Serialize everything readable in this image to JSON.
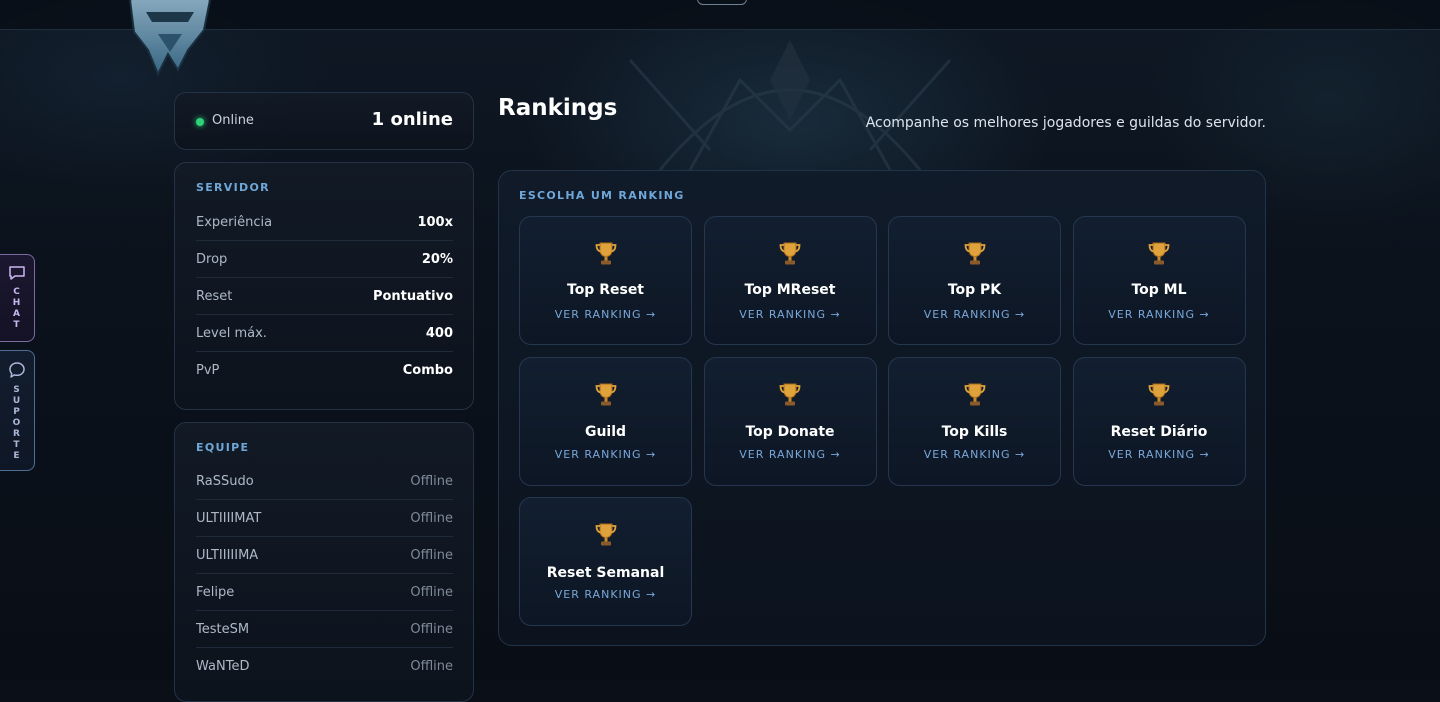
{
  "topbar": {},
  "side_tabs": {
    "chat": {
      "label": "CHAT",
      "icon": "chat-bubble-icon"
    },
    "suporte": {
      "label": "SUPORTE",
      "icon": "support-bubble-icon"
    }
  },
  "online": {
    "label": "Online",
    "count": "1 online",
    "status_color": "#2fd37a"
  },
  "server": {
    "title": "SERVIDOR",
    "rows": [
      {
        "key": "Experiência",
        "value": "100x"
      },
      {
        "key": "Drop",
        "value": "20%"
      },
      {
        "key": "Reset",
        "value": "Pontuativo"
      },
      {
        "key": "Level máx.",
        "value": "400"
      },
      {
        "key": "PvP",
        "value": "Combo"
      }
    ]
  },
  "team": {
    "title": "EQUIPE",
    "members": [
      {
        "name": "RaSSudo",
        "status": "Offline"
      },
      {
        "name": "ULTIIIIMAT",
        "status": "Offline"
      },
      {
        "name": "ULTIIIIIMA",
        "status": "Offline"
      },
      {
        "name": "Felipe",
        "status": "Offline"
      },
      {
        "name": "TesteSM",
        "status": "Offline"
      },
      {
        "name": "WaNTeD",
        "status": "Offline"
      }
    ]
  },
  "main": {
    "title": "Rankings",
    "subtitle": "Acompanhe os melhores jogadores e guildas do servidor.",
    "panel_title": "ESCOLHA UM RANKING",
    "rankings": [
      {
        "name": "Top Reset",
        "link": "VER RANKING →",
        "icon": "trophy-icon"
      },
      {
        "name": "Top MReset",
        "link": "VER RANKING →",
        "icon": "trophy-icon"
      },
      {
        "name": "Top PK",
        "link": "VER RANKING →",
        "icon": "trophy-icon"
      },
      {
        "name": "Top ML",
        "link": "VER RANKING →",
        "icon": "trophy-icon"
      },
      {
        "name": "Guild",
        "link": "VER RANKING →",
        "icon": "trophy-icon"
      },
      {
        "name": "Top Donate",
        "link": "VER RANKING →",
        "icon": "trophy-icon"
      },
      {
        "name": "Top Kills",
        "link": "VER RANKING →",
        "icon": "trophy-icon"
      },
      {
        "name": "Reset Diário",
        "link": "VER RANKING →",
        "icon": "trophy-icon"
      },
      {
        "name": "Reset Semanal",
        "link": "VER RANKING →",
        "icon": "trophy-icon"
      }
    ]
  },
  "colors": {
    "accent": "#6fa7d8",
    "link": "#79a8da",
    "online": "#2fd37a",
    "trophy": "#e0a23a"
  }
}
